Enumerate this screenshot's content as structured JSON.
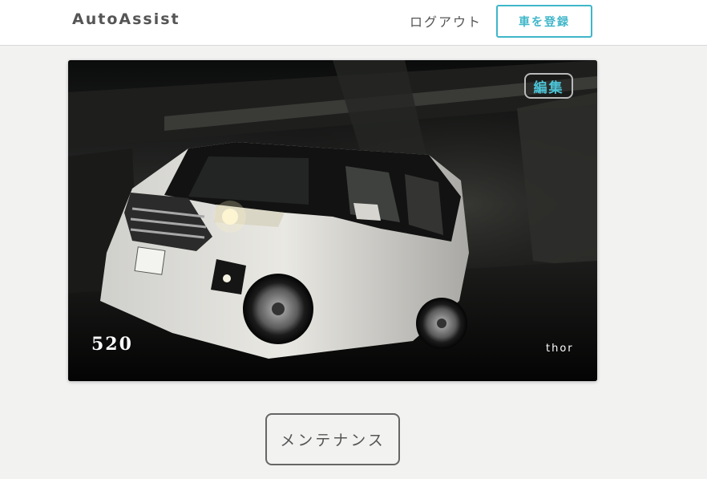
{
  "navbar": {
    "brand": "AutoAssist",
    "logout_label": "ログアウト",
    "register_label": "車を登録"
  },
  "car_card": {
    "edit_label": "編集",
    "car_name": "520",
    "owner": "thor"
  },
  "maintenance_label": "メンテナンス",
  "colors": {
    "accent": "#3fb6c9",
    "background": "#f2f2f1",
    "text": "#555555"
  }
}
